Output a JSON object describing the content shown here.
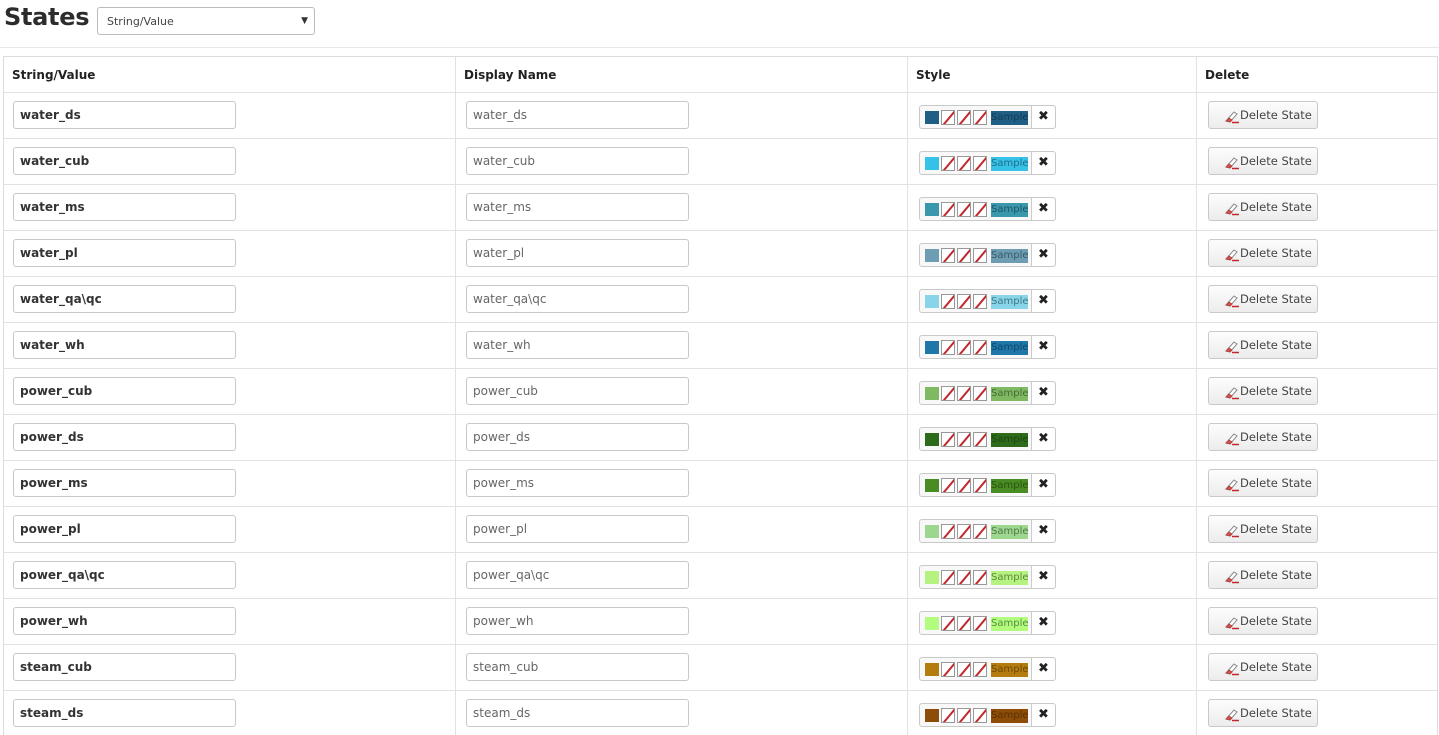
{
  "header": {
    "title": "States",
    "select_value": "String/Value"
  },
  "table": {
    "columns": [
      "String/Value",
      "Display Name",
      "Style",
      "Delete"
    ],
    "sample_label": "Sample",
    "clear_icon": "close-icon",
    "delete_label": "Delete State",
    "rows": [
      {
        "value": "water_ds",
        "display": "water_ds",
        "color": "#1f5f86",
        "text": "#123a55"
      },
      {
        "value": "water_cub",
        "display": "water_cub",
        "color": "#36c2e8",
        "text": "#1f6d85"
      },
      {
        "value": "water_ms",
        "display": "water_ms",
        "color": "#3a98ad",
        "text": "#1f5563"
      },
      {
        "value": "water_pl",
        "display": "water_pl",
        "color": "#6d9db3",
        "text": "#3b5968"
      },
      {
        "value": "water_qa\\qc",
        "display": "water_qa\\qc",
        "color": "#88d5ea",
        "text": "#3f7889"
      },
      {
        "value": "water_wh",
        "display": "water_wh",
        "color": "#1e77a8",
        "text": "#13476a"
      },
      {
        "value": "power_cub",
        "display": "power_cub",
        "color": "#7fba63",
        "text": "#456a33"
      },
      {
        "value": "power_ds",
        "display": "power_ds",
        "color": "#2d6b1a",
        "text": "#1c4410"
      },
      {
        "value": "power_ms",
        "display": "power_ms",
        "color": "#4a8c24",
        "text": "#2a5413"
      },
      {
        "value": "power_pl",
        "display": "power_pl",
        "color": "#9cd68f",
        "text": "#4f7a47"
      },
      {
        "value": "power_qa\\qc",
        "display": "power_qa\\qc",
        "color": "#b6f27f",
        "text": "#5d8840"
      },
      {
        "value": "power_wh",
        "display": "power_wh",
        "color": "#b2fc7e",
        "text": "#5a8a3f"
      },
      {
        "value": "steam_cub",
        "display": "steam_cub",
        "color": "#b47c0e",
        "text": "#6d4a06"
      },
      {
        "value": "steam_ds",
        "display": "steam_ds",
        "color": "#8d4d08",
        "text": "#5a3005"
      }
    ]
  }
}
